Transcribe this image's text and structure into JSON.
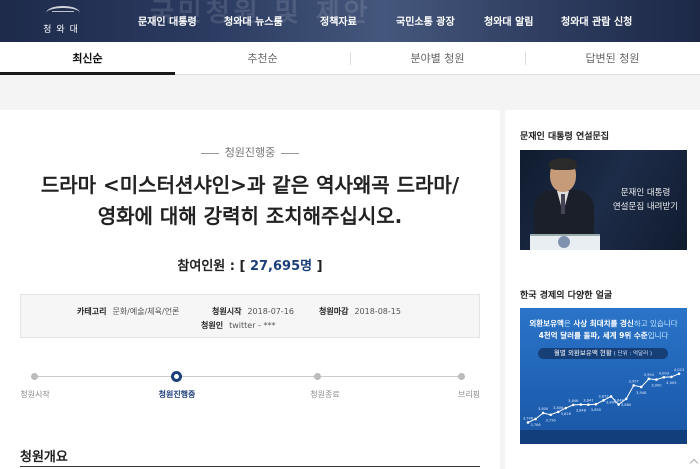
{
  "header": {
    "bg_text": "국민청원 및 제안",
    "logo_text": "청와대",
    "nav": [
      "문재인 대통령",
      "청와대 뉴스룸",
      "정책자료",
      "국민소통 광장",
      "청와대 알림",
      "청와대 관람 신청"
    ]
  },
  "tabs": [
    {
      "label": "최신순",
      "active": true
    },
    {
      "label": "추천순",
      "active": false
    },
    {
      "label": "분야별 청원",
      "active": false
    },
    {
      "label": "답변된 청원",
      "active": false
    }
  ],
  "petition": {
    "status": "청원진행중",
    "title": "드라마 <미스터션샤인>과 같은 역사왜곡 드라마/영화에 대해 강력히 조치해주십시오.",
    "count_label": "참여인원 : [ ",
    "count_value": "27,695명",
    "count_close": " ]",
    "category_label": "카테고리",
    "category_value": "문화/예술/체육/언론",
    "start_label": "청원시작",
    "start_value": "2018-07-16",
    "end_label": "청원마감",
    "end_value": "2018-08-15",
    "author_label": "청원인",
    "author_value": "twitter - ***"
  },
  "steps": [
    {
      "label": "청원시작",
      "active": false
    },
    {
      "label": "청원진행중",
      "active": true
    },
    {
      "label": "청원종료",
      "active": false
    },
    {
      "label": "브리핑",
      "active": false
    }
  ],
  "section": {
    "title": "청원개요"
  },
  "sidebar": {
    "speech_title": "문재인 대통령 연설문집",
    "speech_banner_line1": "문재인 대통령",
    "speech_banner_line2": "연설문집 내려받기",
    "economy_title": "한국 경제의 다양한 얼굴",
    "eco_line1_a": "외환보유액",
    "eco_line1_b": "은",
    "eco_line1_c": " 사상 최대치를 경신",
    "eco_line1_d": "하고 있습니다",
    "eco_line2_a": "4천억 달러",
    "eco_line2_b": "를 돌파, 세계 9위 수준",
    "eco_line2_c": "입니다",
    "eco_pill": "월별 외환보유액 현황",
    "eco_pill_unit": " ( 단위 : 억달러 )",
    "eco_chart_values": [
      3746,
      3766,
      3800,
      3790,
      3806,
      3828,
      3846,
      3848,
      3847,
      3850,
      3872,
      3894,
      3848,
      3880,
      3957,
      3948,
      3994,
      3990,
      4003,
      4005,
      4023
    ]
  }
}
